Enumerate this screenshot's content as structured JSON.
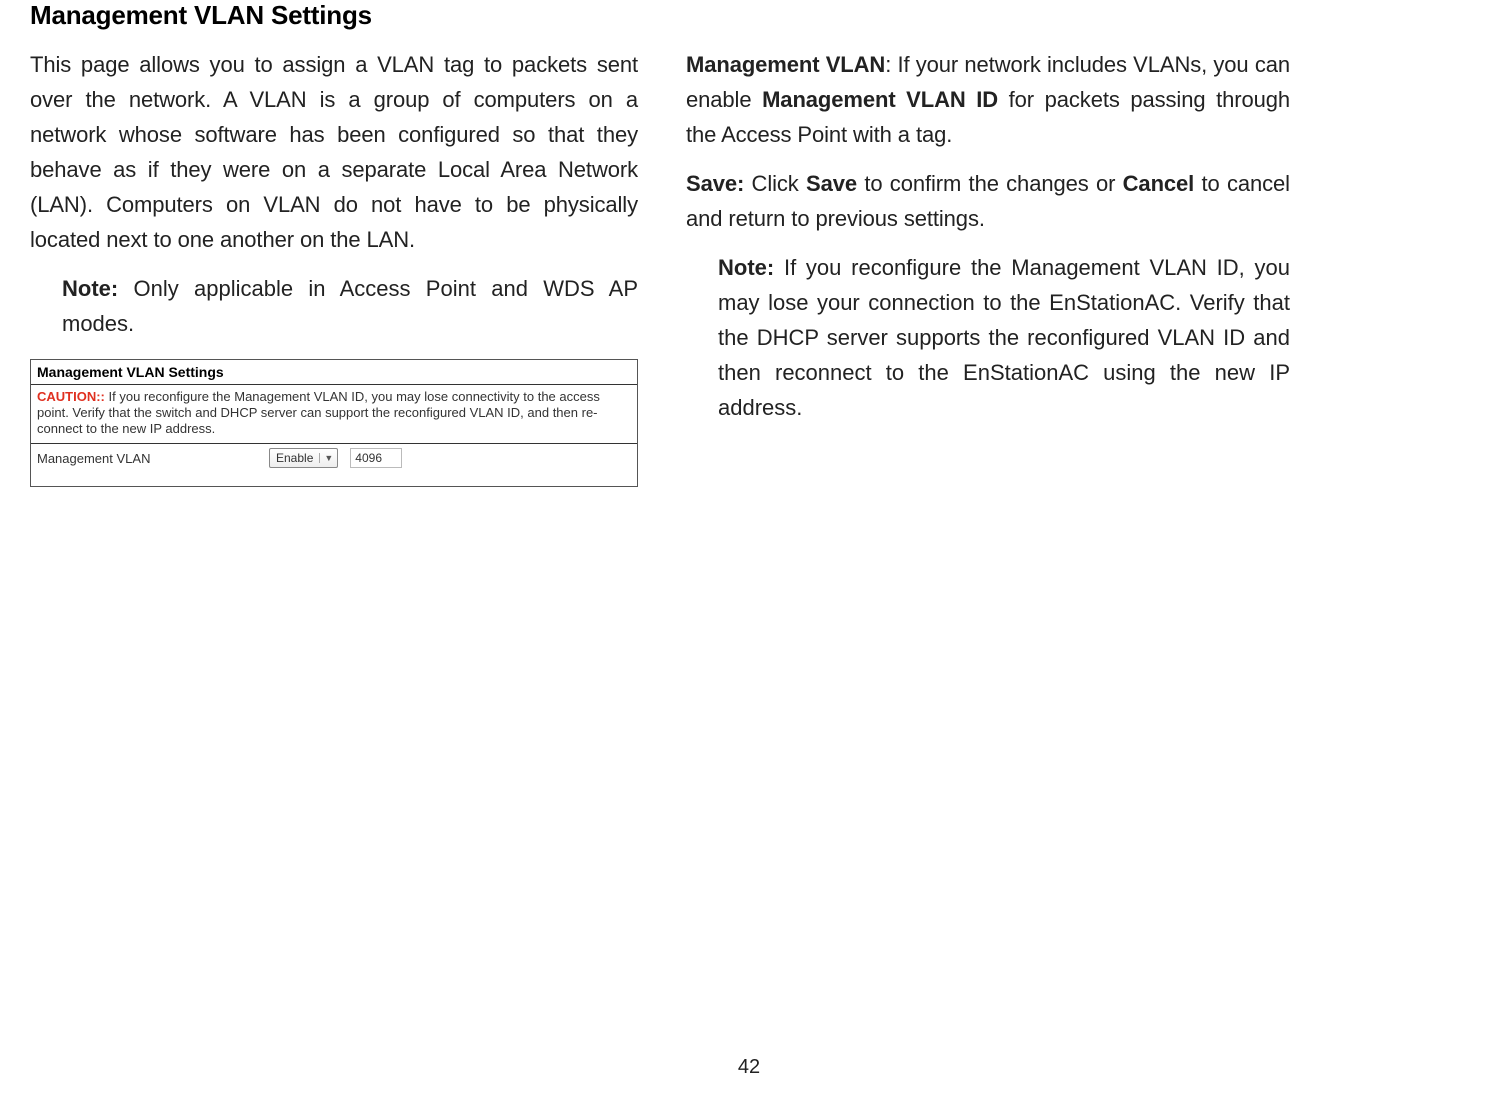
{
  "heading": "Management VLAN Settings",
  "left": {
    "para1": "This page allows you to assign a VLAN tag to packets sent over the network. A VLAN is a group of computers on a network whose software has been configured so that they behave as if they were on a separate Local Area Network (LAN). Computers on VLAN do not have to be physically located next to one another on the LAN.",
    "noteLabel": "Note:",
    "noteText": " Only applicable in Access Point and WDS AP modes."
  },
  "panel": {
    "heading": "Management VLAN Settings",
    "cautionLabel": "CAUTION::",
    "cautionText": " If you reconfigure the Management VLAN ID, you may lose connectivity to the access point. Verify that the switch and DHCP server can support the reconfigured VLAN ID, and then re-connect to the new IP address.",
    "rowLabel": "Management VLAN",
    "selectValue": "Enable",
    "inputValue": "4096"
  },
  "right": {
    "mvlanBold": "Management VLAN",
    "mvlanText1": ": If your network includes VLANs, you can enable ",
    "mvlanIdBold": "Management VLAN ID",
    "mvlanText2": " for packets passing through the Access Point with a tag.",
    "saveBold1": "Save:",
    "saveText1": " Click ",
    "saveBold2": "Save",
    "saveText2": " to confirm the changes or ",
    "cancelBold": "Cancel",
    "saveText3": " to cancel and return to previous settings.",
    "noteBold": "Note:",
    "noteText": " If you reconfigure the Management VLAN ID, you may lose your connection to the EnStationAC. Verify that the DHCP server supports the reconfigured VLAN ID and then reconnect to the EnStationAC using the new IP address."
  },
  "pageNumber": "42"
}
